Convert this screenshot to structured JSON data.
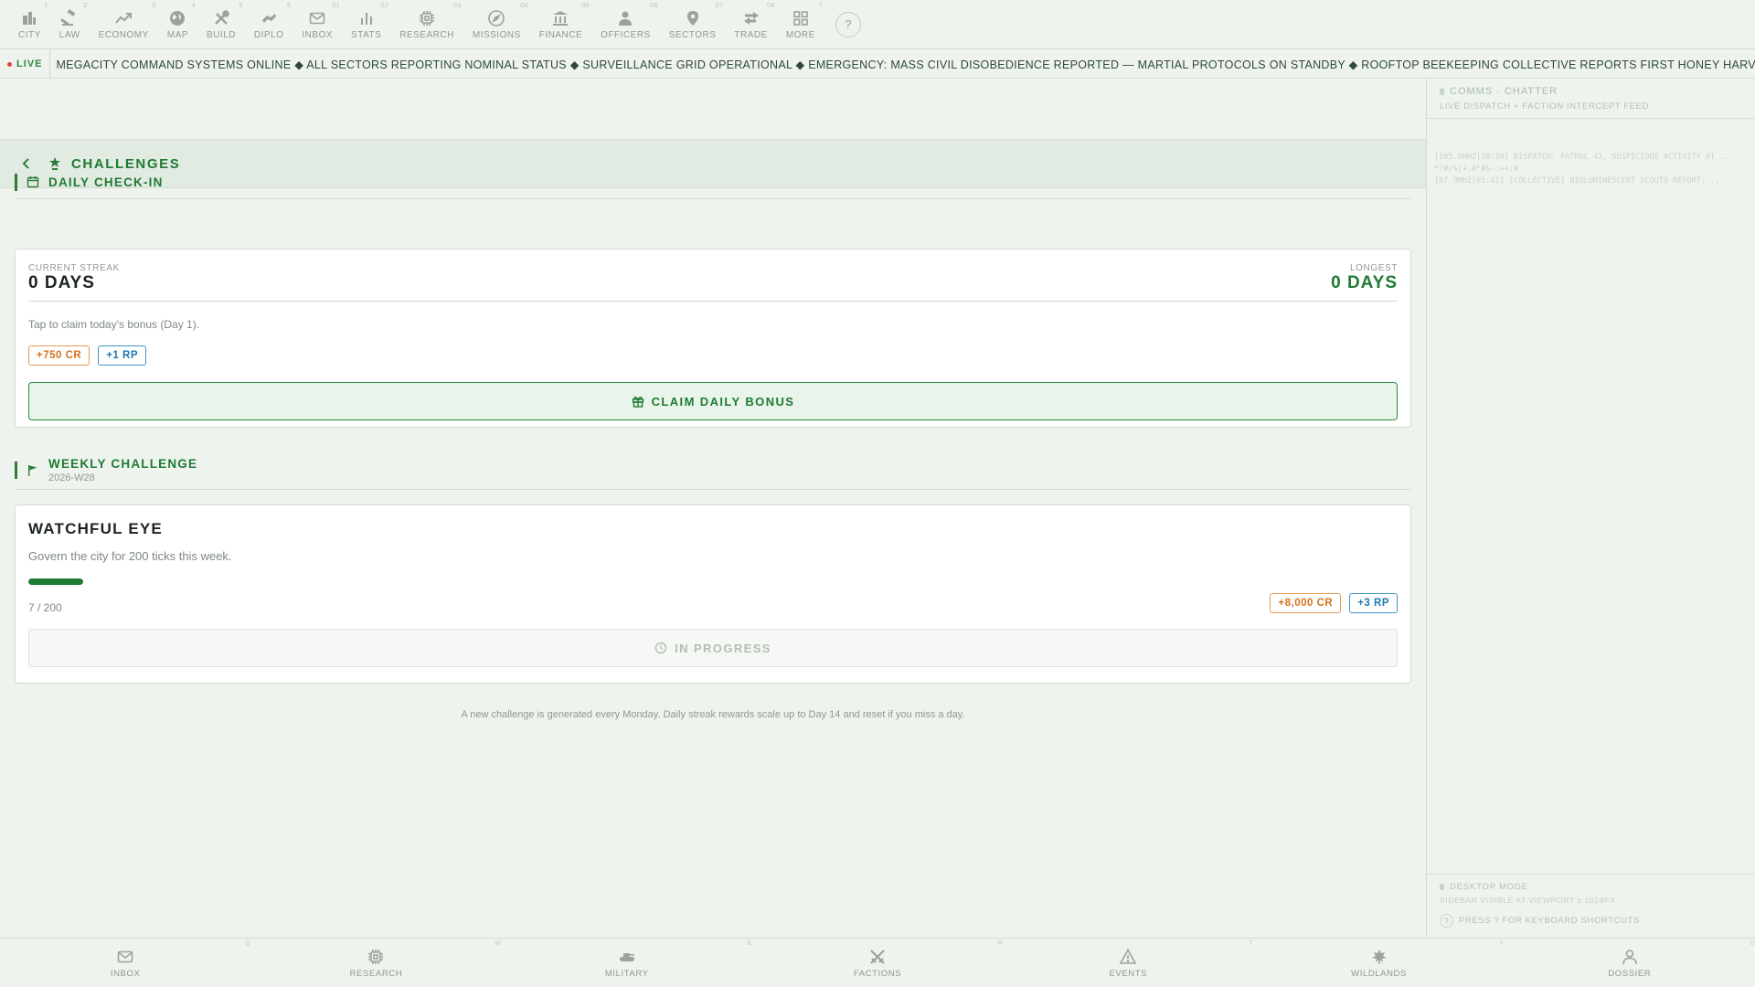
{
  "topnav": {
    "items": [
      {
        "label": "CITY",
        "key": "1",
        "icon": "city-icon"
      },
      {
        "label": "LAW",
        "key": "2",
        "icon": "gavel-icon"
      },
      {
        "label": "ECONOMY",
        "key": "3",
        "icon": "trend-icon"
      },
      {
        "label": "MAP",
        "key": "4",
        "icon": "globe-icon"
      },
      {
        "label": "BUILD",
        "key": "5",
        "icon": "tools-icon"
      },
      {
        "label": "DIPLO",
        "key": "6",
        "icon": "handshake-icon"
      },
      {
        "label": "INBOX",
        "key": "01",
        "icon": "mail-icon"
      },
      {
        "label": "STATS",
        "key": "02",
        "icon": "bar-chart-icon"
      },
      {
        "label": "RESEARCH",
        "key": "03",
        "icon": "chip-icon"
      },
      {
        "label": "MISSIONS",
        "key": "04",
        "icon": "compass-icon"
      },
      {
        "label": "FINANCE",
        "key": "05",
        "icon": "bank-icon"
      },
      {
        "label": "OFFICERS",
        "key": "06",
        "icon": "person-icon"
      },
      {
        "label": "SECTORS",
        "key": "07",
        "icon": "pin-icon"
      },
      {
        "label": "TRADE",
        "key": "08",
        "icon": "swap-icon"
      },
      {
        "label": "MORE",
        "key": "?",
        "icon": "grid-icon"
      }
    ],
    "help_label": "?"
  },
  "ticker": {
    "live_label": "LIVE",
    "text": "MEGACITY COMMAND SYSTEMS ONLINE ◆ ALL SECTORS REPORTING NOMINAL STATUS ◆ SURVEILLANCE GRID OPERATIONAL ◆ EMERGENCY: MASS CIVIL DISOBEDIENCE REPORTED — MARTIAL PROTOCOLS ON STANDBY ◆ ROOFTOP BEEKEEPING COLLECTIVE REPORTS FIRST HONEY HARVEST — QUEUE FORMS IMMEDIA"
  },
  "page": {
    "title": "CHALLENGES"
  },
  "daily": {
    "section_title": "DAILY CHECK-IN",
    "current_streak_label": "CURRENT STREAK",
    "current_streak_value": "0 DAYS",
    "longest_label": "LONGEST",
    "longest_value": "0 DAYS",
    "hint": "Tap to claim today's bonus (Day 1).",
    "reward_cr": "+750 CR",
    "reward_rp": "+1 RP",
    "claim_label": "CLAIM DAILY BONUS"
  },
  "weekly": {
    "section_title": "WEEKLY CHALLENGE",
    "week_id": "2026-W28",
    "challenge_title": "WATCHFUL EYE",
    "description": "Govern the city for 200 ticks this week.",
    "progress_current": 7,
    "progress_total": 200,
    "progress_text": "7 / 200",
    "reward_cr": "+8,000 CR",
    "reward_rp": "+3 RP",
    "status_label": "IN PROGRESS"
  },
  "footnote": "A new challenge is generated every Monday. Daily streak rewards scale up to Day 14 and reset if you miss a day.",
  "sidebar": {
    "title": "COMMS · CHATTER",
    "subtitle": "LIVE DISPATCH + FACTION INTERCEPT FEED",
    "feed": [
      "[105.9MHZ|20:20] DISPATCH: PATROL 42, SUSPICIOUS ACTIVITY AT ...",
      "*?#/%|+.#*#&-:++:#_",
      "[87.9MHZ|05:42] [COLLECTIVE] BIOLUMINESCENT SCOUTS REPORT: ..."
    ],
    "footer_title": "DESKTOP MODE",
    "footer_sub": "SIDEBAR VISIBLE AT VIEWPORT ≥ 1024PX",
    "shortcut_hint": "PRESS ? FOR KEYBOARD SHORTCUTS"
  },
  "bottomnav": {
    "items": [
      {
        "label": "INBOX",
        "key": "Q",
        "icon": "mail-icon"
      },
      {
        "label": "RESEARCH",
        "key": "W",
        "icon": "chip-icon"
      },
      {
        "label": "MILITARY",
        "key": "E",
        "icon": "tank-icon"
      },
      {
        "label": "FACTIONS",
        "key": "R",
        "icon": "swords-icon"
      },
      {
        "label": "EVENTS",
        "key": "T",
        "icon": "alert-icon"
      },
      {
        "label": "WILDLANDS",
        "key": "Y",
        "icon": "leaf-icon"
      },
      {
        "label": "DOSSIER",
        "key": "U",
        "icon": "user-icon"
      }
    ]
  },
  "colors": {
    "accent": "#1f7a33",
    "credits": "#d5721d",
    "research_points": "#1f7ab0",
    "live_dot": "#d84a3a"
  }
}
